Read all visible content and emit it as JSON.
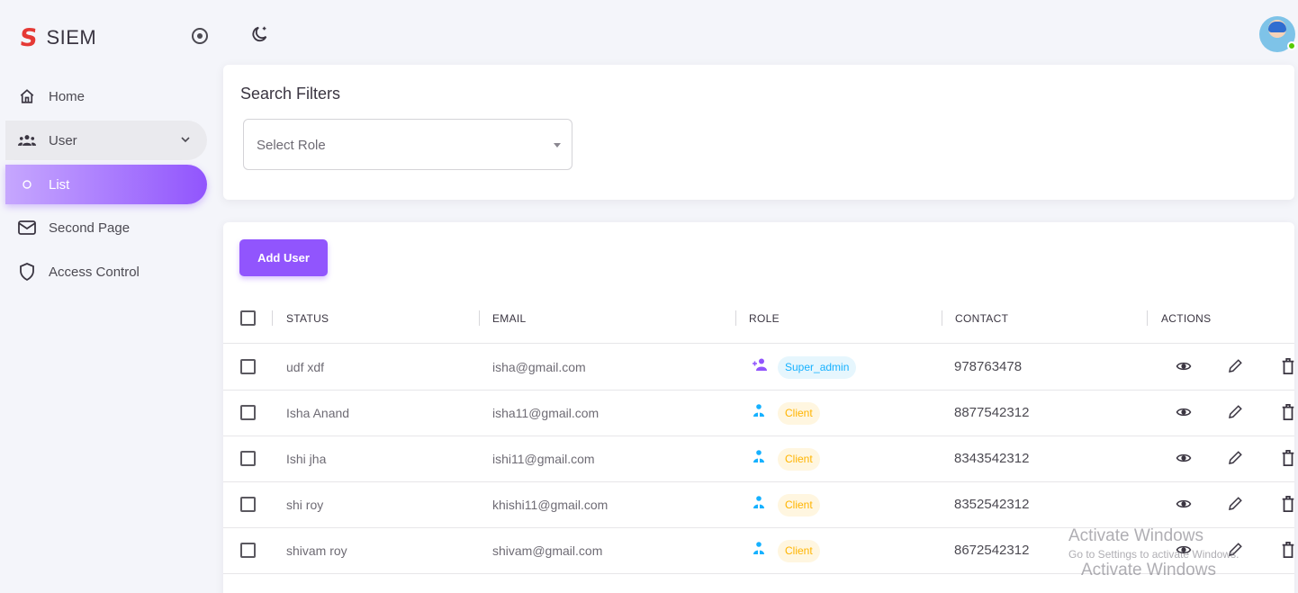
{
  "brand": {
    "logo": "S",
    "name": "SIEM"
  },
  "sidebar": {
    "items": [
      {
        "label": "Home",
        "icon": "home-icon"
      },
      {
        "label": "User",
        "icon": "users-icon"
      },
      {
        "label": "List",
        "icon": "circle-outline-icon"
      },
      {
        "label": "Second Page",
        "icon": "mail-icon"
      },
      {
        "label": "Access Control",
        "icon": "shield-icon"
      }
    ]
  },
  "filters": {
    "title": "Search Filters",
    "role_placeholder": "Select Role"
  },
  "table": {
    "add_label": "Add User",
    "columns": [
      "STATUS",
      "EMAIL",
      "ROLE",
      "CONTACT",
      "ACTIONS"
    ],
    "rows": [
      {
        "status": "udf xdf",
        "email": "isha@gmail.com",
        "role": "Super_admin",
        "contact": "978763478"
      },
      {
        "status": "Isha Anand",
        "email": "isha11@gmail.com",
        "role": "Client",
        "contact": "8877542312"
      },
      {
        "status": "Ishi jha",
        "email": "ishi11@gmail.com",
        "role": "Client",
        "contact": "8343542312"
      },
      {
        "status": "shi roy",
        "email": "khishi11@gmail.com",
        "role": "Client",
        "contact": "8352542312"
      },
      {
        "status": "shivam roy",
        "email": "shivam@gmail.com",
        "role": "Client",
        "contact": "8672542312"
      }
    ]
  },
  "watermark": {
    "title": "Activate Windows",
    "subtitle": "Go to Settings to activate Windows.",
    "title2": "Activate Windows"
  },
  "colors": {
    "primary": "#9155fd",
    "super_admin": "#16b1ff",
    "client": "#ffb400",
    "online": "#56ca00"
  }
}
